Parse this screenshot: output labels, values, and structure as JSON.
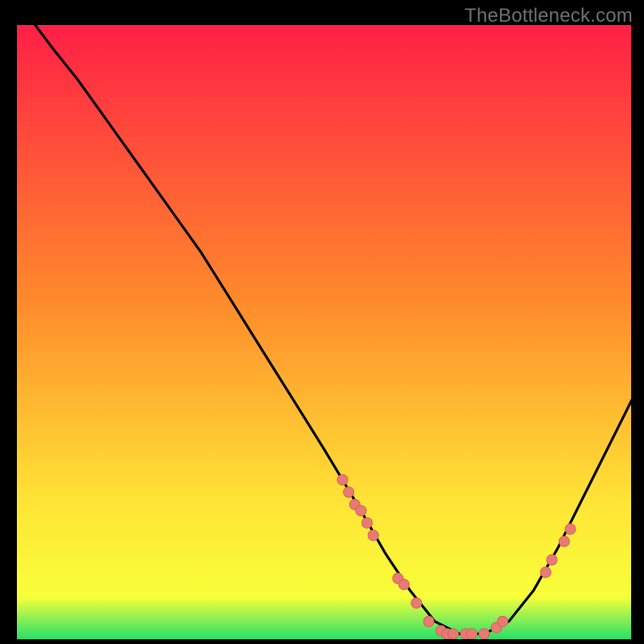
{
  "watermark": "TheBottleneck.com",
  "colors": {
    "gradient_top": "#ff1f46",
    "gradient_mid1": "#ff8a2b",
    "gradient_mid2": "#ffe536",
    "gradient_bottom": "#22e06b",
    "curve": "#000000",
    "marker_fill": "#e77a75",
    "marker_stroke": "#d9605b",
    "frame": "#000000"
  },
  "chart_data": {
    "type": "line",
    "title": "",
    "xlabel": "",
    "ylabel": "",
    "xlim": [
      0,
      100
    ],
    "ylim": [
      0,
      100
    ],
    "grid": false,
    "legend": false,
    "series": [
      {
        "name": "bottleneck-curve",
        "comment": "V-shaped bottleneck curve; y is % bottleneck (high=red, low=green). Estimated from pixel positions.",
        "x": [
          3,
          6,
          10,
          15,
          20,
          25,
          30,
          35,
          40,
          45,
          50,
          53,
          56,
          60,
          64,
          68,
          72,
          76,
          80,
          84,
          88,
          92,
          96,
          100
        ],
        "y": [
          100,
          96,
          91,
          84,
          77,
          70,
          63,
          55,
          47,
          39,
          31,
          26,
          21,
          14,
          8,
          3,
          1,
          1,
          3,
          8,
          15,
          23,
          31,
          39
        ]
      }
    ],
    "markers": {
      "comment": "Scatter points sitting on the curve (pink dots). Estimated positions.",
      "points": [
        {
          "x": 53,
          "y": 26
        },
        {
          "x": 54,
          "y": 24
        },
        {
          "x": 55,
          "y": 22
        },
        {
          "x": 56,
          "y": 21
        },
        {
          "x": 57,
          "y": 19
        },
        {
          "x": 58,
          "y": 17
        },
        {
          "x": 62,
          "y": 10
        },
        {
          "x": 63,
          "y": 9
        },
        {
          "x": 65,
          "y": 6
        },
        {
          "x": 67,
          "y": 3
        },
        {
          "x": 69,
          "y": 1.5
        },
        {
          "x": 70,
          "y": 1
        },
        {
          "x": 71,
          "y": 1
        },
        {
          "x": 73,
          "y": 1
        },
        {
          "x": 74,
          "y": 1
        },
        {
          "x": 76,
          "y": 1
        },
        {
          "x": 78,
          "y": 2
        },
        {
          "x": 79,
          "y": 3
        },
        {
          "x": 86,
          "y": 11
        },
        {
          "x": 87,
          "y": 13
        },
        {
          "x": 89,
          "y": 16
        },
        {
          "x": 90,
          "y": 18
        }
      ]
    }
  }
}
